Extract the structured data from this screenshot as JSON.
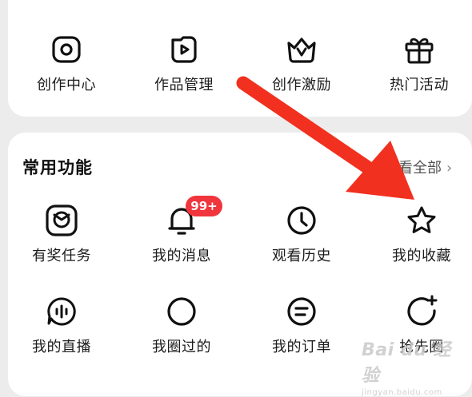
{
  "top_row": [
    {
      "label": "创作中心",
      "icon": "camera-icon"
    },
    {
      "label": "作品管理",
      "icon": "play-icon"
    },
    {
      "label": "创作激励",
      "icon": "crown-icon"
    },
    {
      "label": "热门活动",
      "icon": "gift-icon"
    }
  ],
  "section": {
    "title": "常用功能",
    "see_all": "查看全部",
    "see_all_chevron": "›"
  },
  "row1": [
    {
      "label": "有奖任务",
      "icon": "reward-icon"
    },
    {
      "label": "我的消息",
      "icon": "bell-icon",
      "badge": "99+"
    },
    {
      "label": "观看历史",
      "icon": "clock-icon"
    },
    {
      "label": "我的收藏",
      "icon": "star-icon"
    }
  ],
  "row2": [
    {
      "label": "我的直播",
      "icon": "live-icon"
    },
    {
      "label": "我圈过的",
      "icon": "circle-icon"
    },
    {
      "label": "我的订单",
      "icon": "order-icon"
    },
    {
      "label": "抢先圈",
      "icon": "circle-plus-icon"
    }
  ],
  "watermark": {
    "main": "Bai du 经验",
    "sub": "jingyan.baidu.com"
  },
  "colors": {
    "badge": "#f0353d",
    "arrow": "#f2301f",
    "background": "#ececec",
    "card": "#ffffff"
  }
}
